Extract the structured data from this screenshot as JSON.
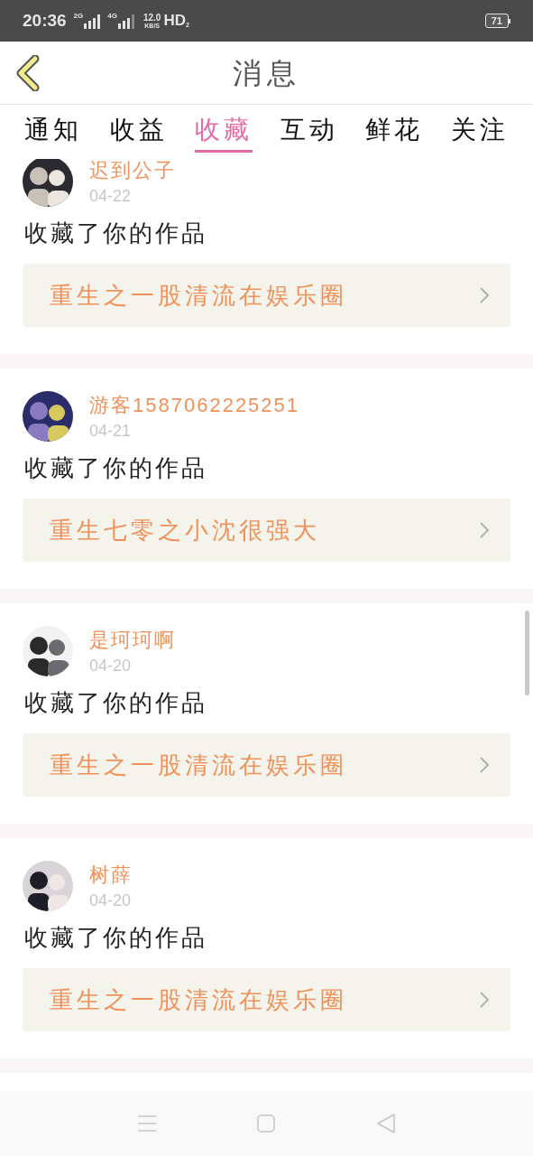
{
  "status_bar": {
    "time": "20:36",
    "network_1": "2G",
    "network_2": "4G",
    "speed": "12.0",
    "speed_unit": "KB/S",
    "hd": "HD",
    "hd_sub": "2",
    "battery": "71"
  },
  "header": {
    "title": "消息"
  },
  "tabs": [
    {
      "label": "通知",
      "selected": false
    },
    {
      "label": "收益",
      "selected": false
    },
    {
      "label": "收藏",
      "selected": true
    },
    {
      "label": "互动",
      "selected": false
    },
    {
      "label": "鲜花",
      "selected": false
    },
    {
      "label": "关注",
      "selected": false
    }
  ],
  "messages": [
    {
      "user": "迟到公子",
      "date": "04-22",
      "action": "收藏了你的作品",
      "work": "重生之一股清流在娱乐圈"
    },
    {
      "user": "游客1587062225251",
      "date": "04-21",
      "action": "收藏了你的作品",
      "work": "重生七零之小沈很强大"
    },
    {
      "user": "是珂珂啊",
      "date": "04-20",
      "action": "收藏了你的作品",
      "work": "重生之一股清流在娱乐圈"
    },
    {
      "user": "树薛",
      "date": "04-20",
      "action": "收藏了你的作品",
      "work": "重生之一股清流在娱乐圈"
    }
  ]
}
